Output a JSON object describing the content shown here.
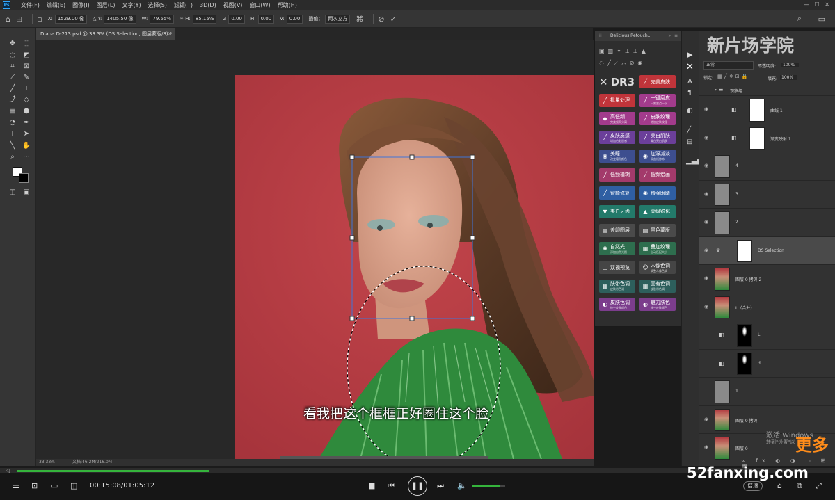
{
  "menu": [
    "文件(F)",
    "编辑(E)",
    "图像(I)",
    "图层(L)",
    "文字(Y)",
    "选择(S)",
    "滤镜(T)",
    "3D(D)",
    "视图(V)",
    "窗口(W)",
    "帮助(H)"
  ],
  "options": {
    "x": "1529.00 像",
    "y": "1405.50 像",
    "w": "79.55%",
    "h": "85.15%",
    "angle": "0.00",
    "hskew": "0.00",
    "vskew": "0.00",
    "interp_label": "插值：",
    "interp": "两次立方"
  },
  "doc_tab": "Diana D-273.psd @ 33.3% (DS Selection, 图层蒙版/8) *",
  "plugin": {
    "title": "Delicious Retouch...",
    "logo": "DR3",
    "buttons": [
      {
        "label": "完美皮肤",
        "sub": "",
        "color": "#c0343a",
        "icon": "brush"
      },
      {
        "label": "批量处理",
        "sub": "",
        "color": "#c0343a",
        "icon": "brush"
      },
      {
        "label": "一键磨皮",
        "sub": "只需要点一下",
        "color": "#a23b8c",
        "icon": "brush"
      },
      {
        "label": "高低频",
        "sub": "完美频率分离",
        "color": "#a23b8c",
        "icon": "gem"
      },
      {
        "label": "皮肤纹理",
        "sub": "增加皮肤纹理",
        "color": "#a23b8c",
        "icon": "brush"
      },
      {
        "label": "皮肤质感",
        "sub": "增加色彩质感",
        "color": "#6b3f9a",
        "icon": "brush"
      },
      {
        "label": "美白肌肤",
        "sub": "美白亮白肌肤",
        "color": "#6b3f9a",
        "icon": "brush"
      },
      {
        "label": "美瞳",
        "sub": "改变瞳孔颜色",
        "color": "#3d4e8f",
        "icon": "eye"
      },
      {
        "label": "加深减淡",
        "sub": "双曲线修饰",
        "color": "#3d4e8f",
        "icon": "eye"
      },
      {
        "label": "低频模糊",
        "sub": "",
        "color": "#a33a6b",
        "icon": "brush"
      },
      {
        "label": "低频绘画",
        "sub": "",
        "color": "#a33a6b",
        "icon": "brush"
      },
      {
        "label": "智能修复",
        "sub": "",
        "color": "#2f5fa3",
        "icon": "brush"
      },
      {
        "label": "增强眼睛",
        "sub": "",
        "color": "#2f5fa3",
        "icon": "eye"
      },
      {
        "label": "美白牙齿",
        "sub": "",
        "color": "#237a6a",
        "icon": "tooth"
      },
      {
        "label": "高级锐化",
        "sub": "",
        "color": "#237a6a",
        "icon": "tri"
      },
      {
        "label": "盖印图层",
        "sub": "",
        "color": "#4a4a4a",
        "icon": "stack"
      },
      {
        "label": "黑色蒙版",
        "sub": "",
        "color": "#4a4a4a",
        "icon": "stack"
      },
      {
        "label": "自然光",
        "sub": "添加自然光照",
        "color": "#2e6e4e",
        "icon": "sun"
      },
      {
        "label": "叠加纹理",
        "sub": "自动匹配大小",
        "color": "#2e6e4e",
        "icon": "grid"
      },
      {
        "label": "双视预览",
        "sub": "",
        "color": "#454545",
        "icon": "split"
      },
      {
        "label": "人像色调",
        "sub": "调整人像色调",
        "color": "#454545",
        "icon": "person"
      },
      {
        "label": "肤带色调",
        "sub": "皮肤带色调",
        "color": "#2d5f5c",
        "icon": "grid"
      },
      {
        "label": "固有色调",
        "sub": "皮肤带色调",
        "color": "#2d5f5c",
        "icon": "grid"
      },
      {
        "label": "皮肤色调",
        "sub": "统一皮肤颜色",
        "color": "#7b3d8c",
        "icon": "drop"
      },
      {
        "label": "魅力肤色",
        "sub": "统一皮肤颜色",
        "color": "#7b3d8c",
        "icon": "drop"
      }
    ]
  },
  "layers_panel": {
    "blend": "正常",
    "opacity_label": "不透明度:",
    "opacity": "100%",
    "lock_label": "锁定:",
    "fill_label": "填充:",
    "fill": "100%",
    "rows": [
      {
        "name": "观察组",
        "kind": "group",
        "eye": false
      },
      {
        "name": "曲线 1",
        "kind": "adj",
        "eye": true
      },
      {
        "name": "渐变映射 1",
        "kind": "adj",
        "eye": true
      },
      {
        "name": "4",
        "kind": "gray",
        "eye": true
      },
      {
        "name": "3",
        "kind": "gray",
        "eye": true
      },
      {
        "name": "2",
        "kind": "gray",
        "eye": true
      },
      {
        "name": "DS Selection",
        "kind": "mask",
        "eye": true,
        "selected": true
      },
      {
        "name": "图层 0 拷贝 2",
        "kind": "photo",
        "eye": true
      },
      {
        "name": "L（合并）",
        "kind": "photo",
        "eye": true
      },
      {
        "name": "L",
        "kind": "black",
        "eye": false
      },
      {
        "name": "d",
        "kind": "black",
        "eye": false
      },
      {
        "name": "1",
        "kind": "gray",
        "eye": false
      },
      {
        "name": "图层 0 拷贝",
        "kind": "photo",
        "eye": true
      },
      {
        "name": "图层 0",
        "kind": "photo",
        "eye": true
      }
    ]
  },
  "status": {
    "zoom": "33.33%",
    "doc": "文档:46.2M/216.0M"
  },
  "subtitle": "看我把这个框框正好圈住这个脸",
  "watermark": "新片场学院",
  "windows_activate": "激活 Windows",
  "windows_goto": "转到\"设置\"以",
  "more_text": "更多",
  "player": {
    "time": "00:15:08/01:05:12",
    "progress": 0.24,
    "volume": 0.85,
    "speed_label": "倍速",
    "site": "52fanxing.com"
  },
  "colors": {
    "accent": "#35b43c",
    "backdrop": "#b23a40",
    "dress": "#2f8a3c"
  }
}
